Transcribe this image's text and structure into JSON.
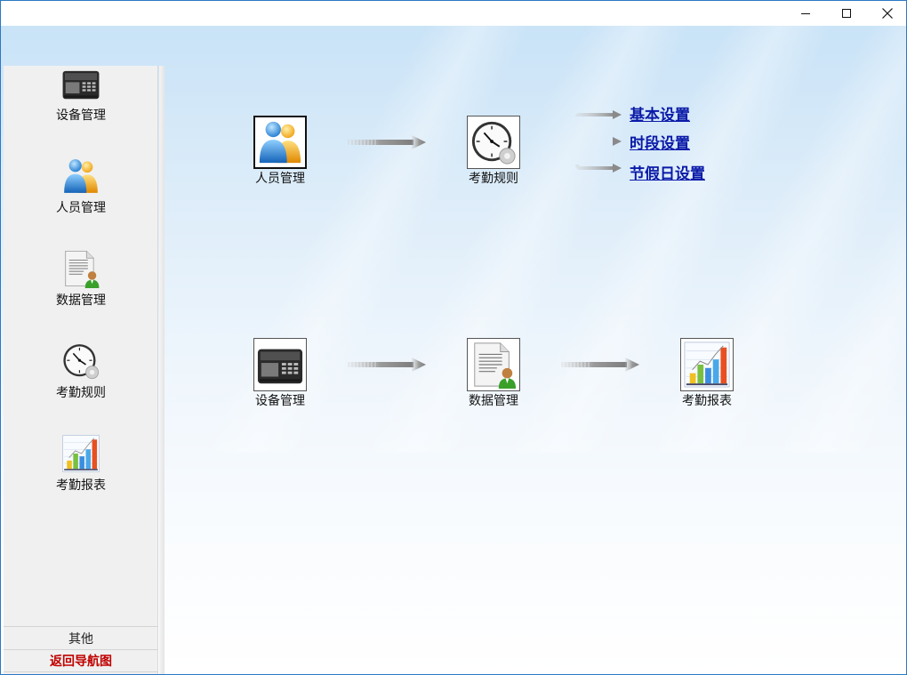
{
  "window": {
    "controls": {
      "minimize": "minimize-icon",
      "maximize": "maximize-icon",
      "close": "close-icon"
    }
  },
  "sidebar": {
    "items": [
      {
        "label": "设备管理",
        "icon": "device-terminal-icon"
      },
      {
        "label": "人员管理",
        "icon": "people-icon"
      },
      {
        "label": "数据管理",
        "icon": "data-document-icon"
      },
      {
        "label": "考勤规则",
        "icon": "clock-icon"
      },
      {
        "label": "考勤报表",
        "icon": "bar-chart-icon"
      }
    ],
    "other_label": "其他",
    "back_label": "返回导航图"
  },
  "flow": {
    "row1": [
      {
        "label": "人员管理",
        "icon": "people-icon"
      },
      {
        "label": "考勤规则",
        "icon": "clock-icon"
      }
    ],
    "row2": [
      {
        "label": "设备管理",
        "icon": "device-terminal-icon"
      },
      {
        "label": "数据管理",
        "icon": "data-document-icon"
      },
      {
        "label": "考勤报表",
        "icon": "bar-chart-icon"
      }
    ],
    "links": [
      {
        "label": "基本设置"
      },
      {
        "label": "时段设置"
      },
      {
        "label": "节假日设置"
      }
    ]
  },
  "colors": {
    "link": "#0a1aa8",
    "back": "#c00000",
    "window_border": "#2b78c5"
  }
}
